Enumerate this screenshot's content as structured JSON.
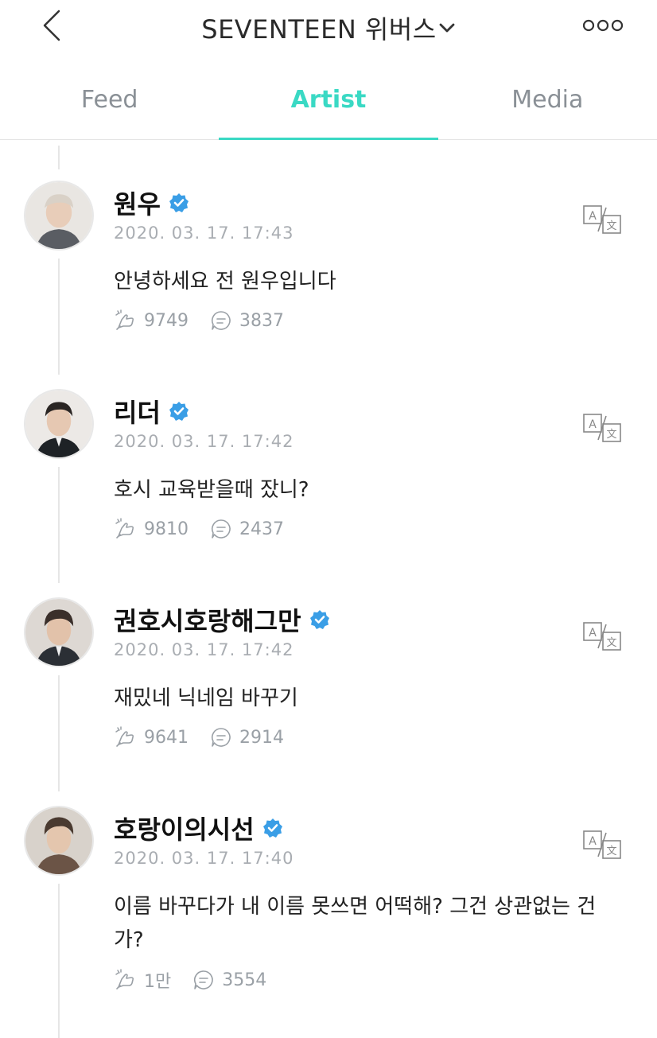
{
  "header": {
    "title": "SEVENTEEN 위버스",
    "back_icon": "chevron-left-icon",
    "dropdown_icon": "chevron-down-icon",
    "more_icon": "more-dots-icon"
  },
  "tabs": [
    {
      "label": "Feed",
      "active": false
    },
    {
      "label": "Artist",
      "active": true
    },
    {
      "label": "Media",
      "active": false
    }
  ],
  "colors": {
    "accent": "#3ad9c4",
    "verified": "#3a9ee6",
    "muted": "#9aa0a6"
  },
  "posts": [
    {
      "name": "원우",
      "time": "2020. 03. 17. 17:43",
      "text": "안녕하세요 전 원우입니다",
      "likes": "9749",
      "comments": "3837"
    },
    {
      "name": "리더",
      "time": "2020. 03. 17. 17:42",
      "text": "호시 교육받을때 잤니?",
      "likes": "9810",
      "comments": "2437"
    },
    {
      "name": "권호시호랑해그만",
      "time": "2020. 03. 17. 17:42",
      "text": "재밌네 닉네임 바꾸기",
      "likes": "9641",
      "comments": "2914"
    },
    {
      "name": "호랑이의시선",
      "time": "2020. 03. 17. 17:40",
      "text": "이름 바꾸다가 내 이름 못쓰면 어떡해? 그건 상관없는 건가?",
      "likes": "1만",
      "comments": "3554"
    }
  ]
}
